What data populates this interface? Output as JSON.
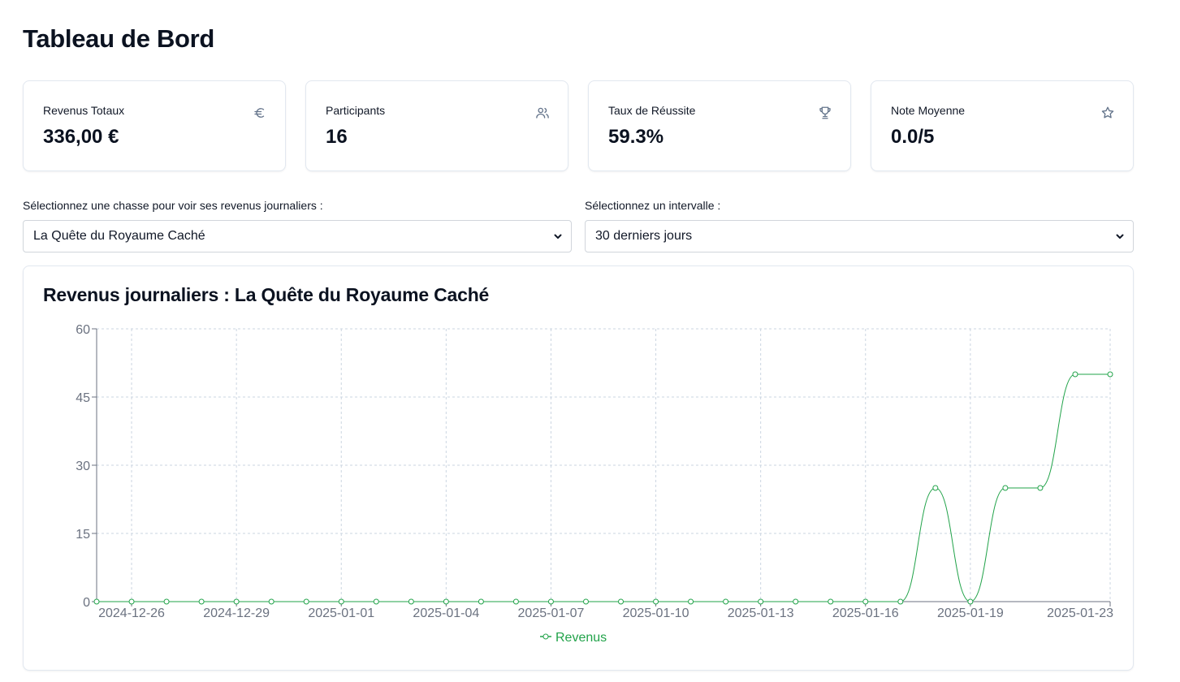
{
  "page": {
    "title": "Tableau de Bord"
  },
  "stats": [
    {
      "label": "Revenus Totaux",
      "value": "336,00 €",
      "icon": "euro-icon"
    },
    {
      "label": "Participants",
      "value": "16",
      "icon": "users-icon"
    },
    {
      "label": "Taux de Réussite",
      "value": "59.3%",
      "icon": "trophy-icon"
    },
    {
      "label": "Note Moyenne",
      "value": "0.0/5",
      "icon": "star-icon"
    }
  ],
  "filters": {
    "hunt_label": "Sélectionnez une chasse pour voir ses revenus journaliers :",
    "hunt_selected": "La Quête du Royaume Caché",
    "interval_label": "Sélectionnez un intervalle :",
    "interval_selected": "30 derniers jours"
  },
  "colors": {
    "series": "#22a34a",
    "grid": "#cbd5e1",
    "axis": "#6b7280",
    "icon": "#64748b"
  },
  "chart_data": {
    "type": "line",
    "title": "Revenus journaliers : La Quête du Royaume Caché",
    "x": [
      "2024-12-25",
      "2024-12-26",
      "2024-12-27",
      "2024-12-28",
      "2024-12-29",
      "2024-12-30",
      "2024-12-31",
      "2025-01-01",
      "2025-01-02",
      "2025-01-03",
      "2025-01-04",
      "2025-01-05",
      "2025-01-06",
      "2025-01-07",
      "2025-01-08",
      "2025-01-09",
      "2025-01-10",
      "2025-01-11",
      "2025-01-12",
      "2025-01-13",
      "2025-01-14",
      "2025-01-15",
      "2025-01-16",
      "2025-01-17",
      "2025-01-18",
      "2025-01-19",
      "2025-01-20",
      "2025-01-21",
      "2025-01-22",
      "2025-01-23"
    ],
    "x_tick_labels": [
      "2024-12-26",
      "2024-12-29",
      "2025-01-01",
      "2025-01-04",
      "2025-01-07",
      "2025-01-10",
      "2025-01-13",
      "2025-01-16",
      "2025-01-19",
      "2025-01-23"
    ],
    "series": [
      {
        "name": "Revenus",
        "values": [
          0,
          0,
          0,
          0,
          0,
          0,
          0,
          0,
          0,
          0,
          0,
          0,
          0,
          0,
          0,
          0,
          0,
          0,
          0,
          0,
          0,
          0,
          0,
          0,
          25,
          0,
          25,
          25,
          50,
          50
        ]
      }
    ],
    "y_ticks": [
      0,
      15,
      30,
      45,
      60
    ],
    "ylim": [
      0,
      60
    ],
    "grid": true,
    "legend_position": "bottom-center"
  }
}
